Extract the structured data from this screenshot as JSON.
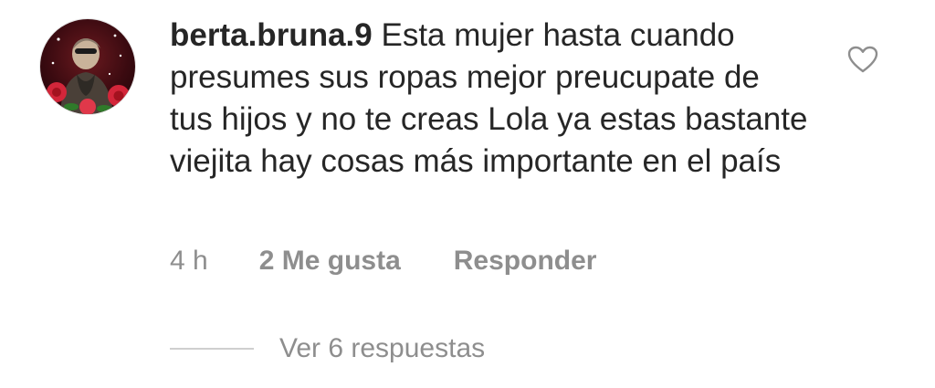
{
  "comment": {
    "username": "berta.bruna.9",
    "text": "Esta mujer hasta cuando presumes sus ropas mejor preucupate de tus hijos y no te creas Lola ya estas bastante viejita hay cosas más importante en el país",
    "time": "4 h",
    "likes": "2 Me gusta",
    "reply_label": "Responder",
    "view_replies": "Ver 6 respuestas"
  },
  "icons": {
    "like": "heart-outline-icon"
  },
  "colors": {
    "text": "#262626",
    "secondary": "#8e8e8e",
    "divider": "#cfcfcf"
  }
}
